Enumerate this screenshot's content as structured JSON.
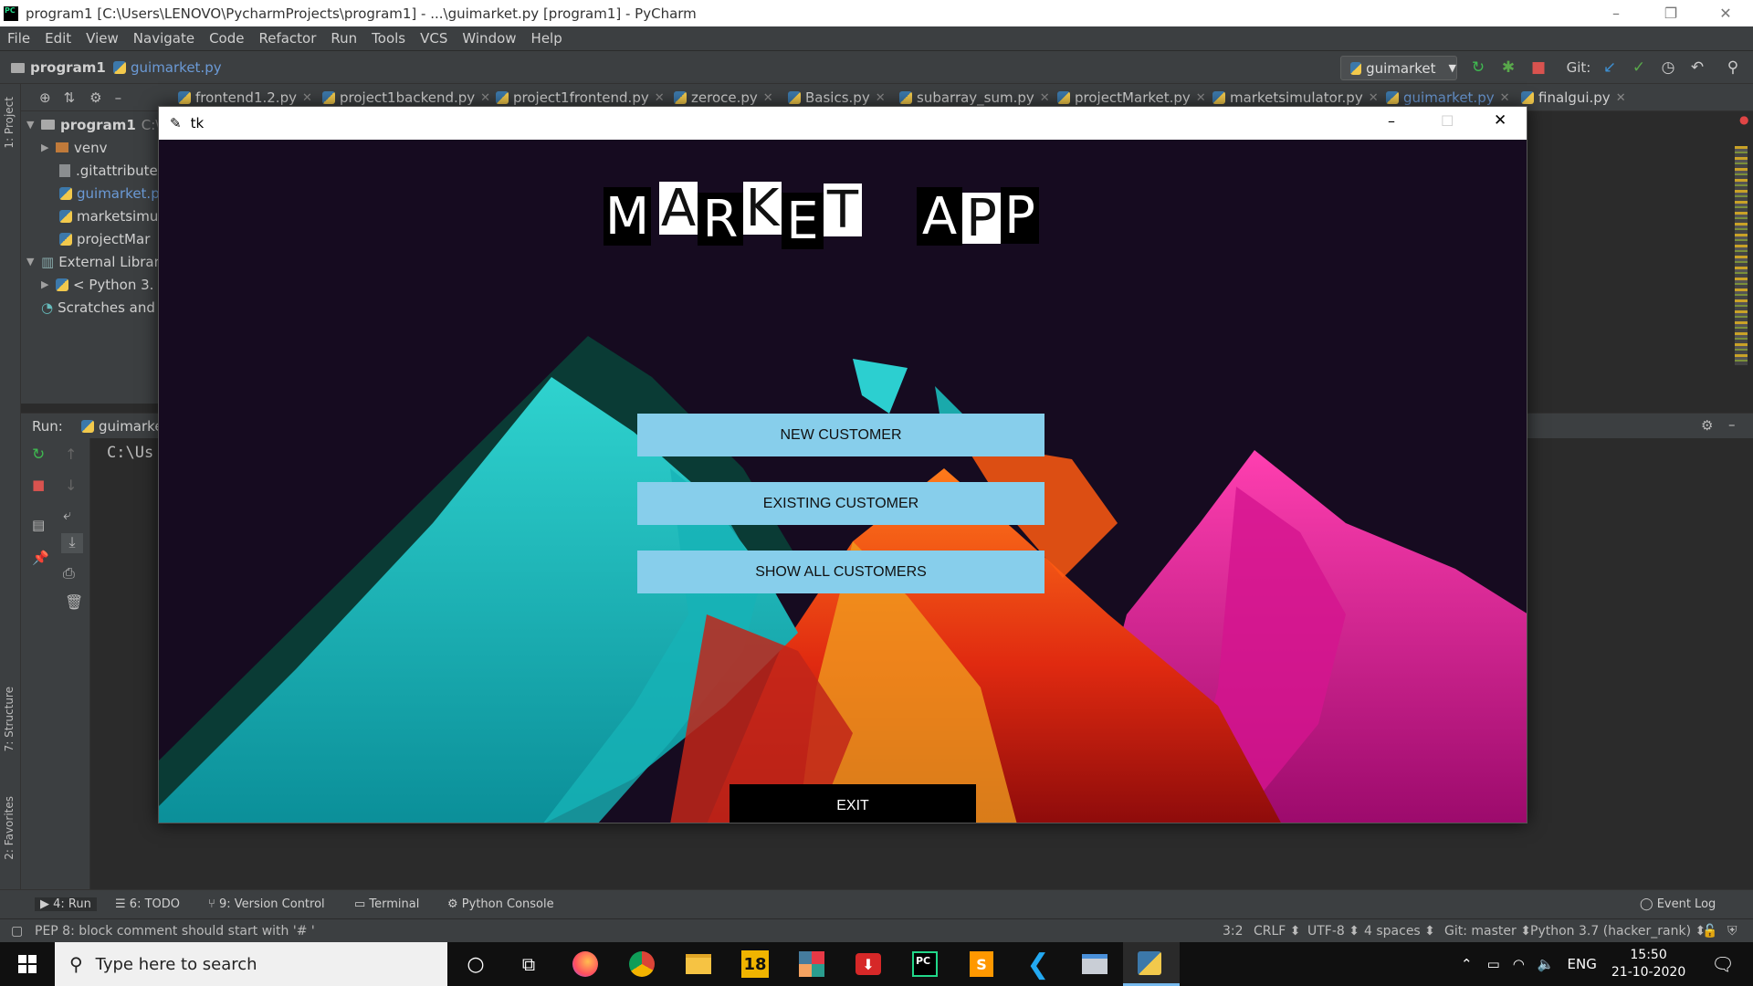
{
  "window": {
    "title": "program1 [C:\\Users\\LENOVO\\PycharmProjects\\program1] - ...\\guimarket.py [program1] - PyCharm",
    "minimize": "–",
    "restore": "❐",
    "close": "✕"
  },
  "menu": [
    "File",
    "Edit",
    "View",
    "Navigate",
    "Code",
    "Refactor",
    "Run",
    "Tools",
    "VCS",
    "Window",
    "Help"
  ],
  "navbar": {
    "project": "program1",
    "file": "guimarket.py",
    "run_config": "guimarket",
    "git_label": "Git:"
  },
  "left_tabs": {
    "project": "1: Project",
    "structure": "7: Structure",
    "favorites": "2: Favorites"
  },
  "project_tree": [
    {
      "label": "program1",
      "suffix": "C:\\",
      "kind": "root"
    },
    {
      "label": "venv",
      "kind": "folder"
    },
    {
      "label": ".gitattribute",
      "kind": "file"
    },
    {
      "label": "guimarket.p",
      "kind": "pyfile-active"
    },
    {
      "label": "marketsimu",
      "kind": "pyfile"
    },
    {
      "label": "projectMar",
      "kind": "pyfile"
    },
    {
      "label": "External Librar",
      "kind": "lib"
    },
    {
      "label": "< Python 3.",
      "kind": "python"
    },
    {
      "label": "Scratches and",
      "kind": "scratch"
    }
  ],
  "editor_tabs": [
    "frontend1.2.py",
    "project1backend.py",
    "project1frontend.py",
    "zeroce.py",
    "Basics.py",
    "subarray_sum.py",
    "projectMarket.py",
    "marketsimulator.py",
    "guimarket.py",
    "finalgui.py"
  ],
  "run_panel": {
    "label": "Run:",
    "config": "guimarke",
    "output": "C:\\Us"
  },
  "bottom_tabs": {
    "run": "4: Run",
    "todo": "6: TODO",
    "vcs": "9: Version Control",
    "terminal": "Terminal",
    "console": "Python Console",
    "event_log": "Event Log"
  },
  "status": {
    "message": "PEP 8: block comment should start with '# '",
    "position": "3:2",
    "line_sep": "CRLF ⬍",
    "encoding": "UTF-8 ⬍",
    "indent": "4 spaces ⬍",
    "git": "Git: master ⬍",
    "interpreter": "Python 3.7 (hacker_rank) ⬍"
  },
  "taskbar": {
    "search_placeholder": "Type here to search",
    "language": "ENG",
    "time": "15:50",
    "date": "21-10-2020",
    "badge_18": "18"
  },
  "tk_app": {
    "title": "tk",
    "heading_letters": [
      "M",
      "A",
      "R",
      "K",
      "E",
      "T",
      "A",
      "P",
      "P"
    ],
    "buttons": {
      "new_customer": "NEW CUSTOMER",
      "existing_customer": "EXISTING CUSTOMER",
      "show_all": "SHOW ALL CUSTOMERS",
      "exit": "EXIT"
    }
  },
  "colors": {
    "ide_bg": "#2b2b2b",
    "ide_panel": "#3c3f41",
    "button_blue": "#87ceeb",
    "canvas_bg": "#160b20",
    "mountain_teal": "#17b3b6",
    "mountain_red": "#d8240f",
    "mountain_magenta": "#c0107f"
  }
}
